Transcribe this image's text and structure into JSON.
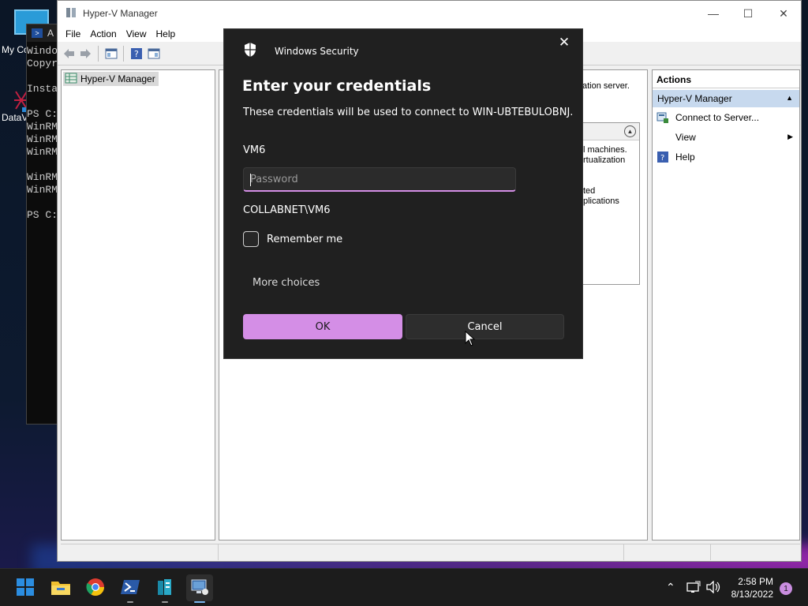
{
  "desktop": {
    "icons": [
      {
        "label": "My Co"
      },
      {
        "label": "DataV"
      }
    ]
  },
  "powershell": {
    "title": "A",
    "lines": [
      "Windo",
      "Copyr",
      "",
      "Insta",
      "",
      "PS C:",
      "WinRM",
      "WinRM",
      "WinRM",
      "",
      "WinRM",
      "WinRM",
      "",
      "PS C:"
    ]
  },
  "hyperv": {
    "title": "Hyper-V Manager",
    "menu": [
      "File",
      "Action",
      "View",
      "Help"
    ],
    "tree_root": "Hyper-V Manager",
    "center": {
      "message": "ation server.",
      "box_lines": [
        "l machines.",
        "rtualization",
        "",
        "",
        "ted",
        "plications"
      ]
    },
    "actions": {
      "header": "Actions",
      "section": "Hyper-V Manager",
      "items": [
        {
          "label": "Connect to Server...",
          "icon": "server-connect-icon"
        },
        {
          "label": "View",
          "icon": ""
        },
        {
          "label": "Help",
          "icon": "help-icon"
        }
      ]
    }
  },
  "dialog": {
    "app_name": "Windows Security",
    "title": "Enter your credentials",
    "description": "These credentials will be used to connect to WIN-UBTEBULOBNJ.",
    "username": "VM6",
    "password_placeholder": "Password",
    "password_value": "",
    "domain_user": "COLLABNET\\VM6",
    "remember_label": "Remember me",
    "remember_checked": false,
    "more_choices": "More choices",
    "ok_label": "OK",
    "cancel_label": "Cancel",
    "accent_color": "#d48ee6"
  },
  "taskbar": {
    "apps": [
      "start-icon",
      "file-explorer-icon",
      "chrome-icon",
      "powershell-icon",
      "server-manager-icon",
      "hyper-v-manager-icon"
    ],
    "clock_time": "2:58 PM",
    "clock_date": "8/13/2022",
    "notification_count": "1"
  }
}
